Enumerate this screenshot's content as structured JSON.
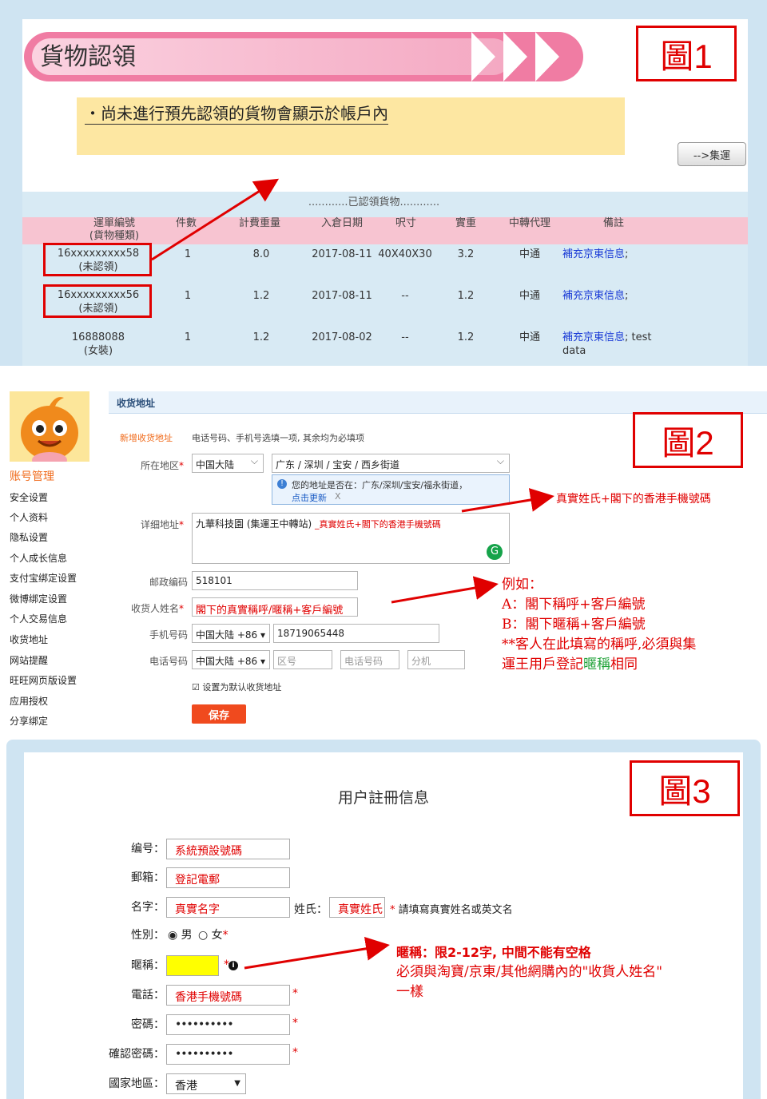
{
  "labels": {
    "fig1": "圖1",
    "fig2": "圖2",
    "fig3": "圖3"
  },
  "panel1": {
    "banner_title": "貨物認領",
    "notice": "‧尚未進行預先認領的貨物會顯示於帳戶內",
    "ship_button": "-->集運",
    "table_title": "............已認領貨物............",
    "headers": [
      "運單編號\n(貨物種類)",
      "件數",
      "計費重量",
      "入倉日期",
      "呎寸",
      "實重",
      "中轉代理",
      "備註"
    ],
    "rows": [
      {
        "id": "16xxxxxxxxx58",
        "type": "(未認領)",
        "qty": "1",
        "cw": "8.0",
        "date": "2017-08-11",
        "dim": "40X40X30",
        "aw": "3.2",
        "agent": "中通",
        "note_link": "補充京東信息",
        "note_rest": ";"
      },
      {
        "id": "16xxxxxxxxx56",
        "type": "(未認領)",
        "qty": "1",
        "cw": "1.2",
        "date": "2017-08-11",
        "dim": "--",
        "aw": "1.2",
        "agent": "中通",
        "note_link": "補充京東信息",
        "note_rest": ";"
      },
      {
        "id": "16888088",
        "type": "(女裝)",
        "qty": "1",
        "cw": "1.2",
        "date": "2017-08-02",
        "dim": "--",
        "aw": "1.2",
        "agent": "中通",
        "note_link": "補充京東信息",
        "note_rest": "; test data"
      }
    ]
  },
  "panel2": {
    "section_title": "收货地址",
    "sidebar_heading": "账号管理",
    "sidebar": [
      "安全设置",
      "个人资料",
      "隐私设置",
      "个人成长信息",
      "支付宝绑定设置",
      "微博绑定设置",
      "个人交易信息",
      "收货地址",
      "网站提醒",
      "旺旺网页版设置",
      "应用授权",
      "分享绑定"
    ],
    "new_addr": "新增收货地址",
    "hint": "电话号码、手机号选填一项, 其余均为必填项",
    "region_label": "所在地区",
    "region_value": "中国大陆",
    "region_detail": "广东 / 深圳 / 宝安 / 西乡街道",
    "tip_text": "您的地址是否在：广东/深圳/宝安/福永街道，",
    "tip_link": "点击更新",
    "tip_close": "X",
    "detail_label": "详细地址",
    "detail_value": "九華科技園 (集運王中轉站) ",
    "detail_red": "_真實姓氏+閣下的香港手機號碼",
    "zip_label": "邮政编码",
    "zip_value": "518101",
    "name_label": "收货人姓名",
    "name_value": "閣下的真實稱呼/暱稱+客戶編號",
    "mobile_label": "手机号码",
    "mobile_code": "中国大陆 +86",
    "mobile_value": "18719065448",
    "phone_label": "电话号码",
    "phone_code": "中国大陆 +86",
    "phone_area": "区号",
    "phone_num": "电话号码",
    "phone_ext": "分机",
    "default_check": "设置为默认收货地址",
    "save": "保存",
    "ann1": "真實姓氏+閣下的香港手機號碼",
    "ann2_l1": "例如：",
    "ann2_l2": "A：閣下稱呼+客戶編號",
    "ann2_l3": "B：閣下暱稱+客戶編號",
    "ann2_l4": "**客人在此填寫的稱呼,必須與集",
    "ann2_l5a": "運王用戶登記",
    "ann2_l5b": "暱稱",
    "ann2_l5c": "相同"
  },
  "panel3": {
    "title": "用户註冊信息",
    "id_label": "编号：",
    "id_value": "系統預設號碼",
    "email_label": "郵箱：",
    "email_value": "登記電郵",
    "name_label": "名字：",
    "name_value": "真實名字",
    "surname_label": "姓氏：",
    "surname_value": "真實姓氏",
    "name_hint": "請填寫真實姓名或英文名",
    "gender_label": "性別：",
    "male": "男",
    "female": "女",
    "nick_label": "暱稱：",
    "phone_label": "電話：",
    "phone_value": "香港手機號碼",
    "pwd_label": "密碼：",
    "pwd_value": "••••••••••",
    "pwd2_label": "確認密碼：",
    "pwd2_value": "••••••••••",
    "country_label": "國家地區：",
    "country_value": "香港",
    "ann_l1": "暱稱：限2-12字, 中間不能有空格",
    "ann_l2": "必須與淘寶/京東/其他網購內的\"收貨人姓名\"",
    "ann_l3": "一樣"
  },
  "colors": {
    "red": "#e00000",
    "banner_pink": "#f07ca3",
    "table_head": "#f7c4d1",
    "save": "#f04a1e"
  }
}
